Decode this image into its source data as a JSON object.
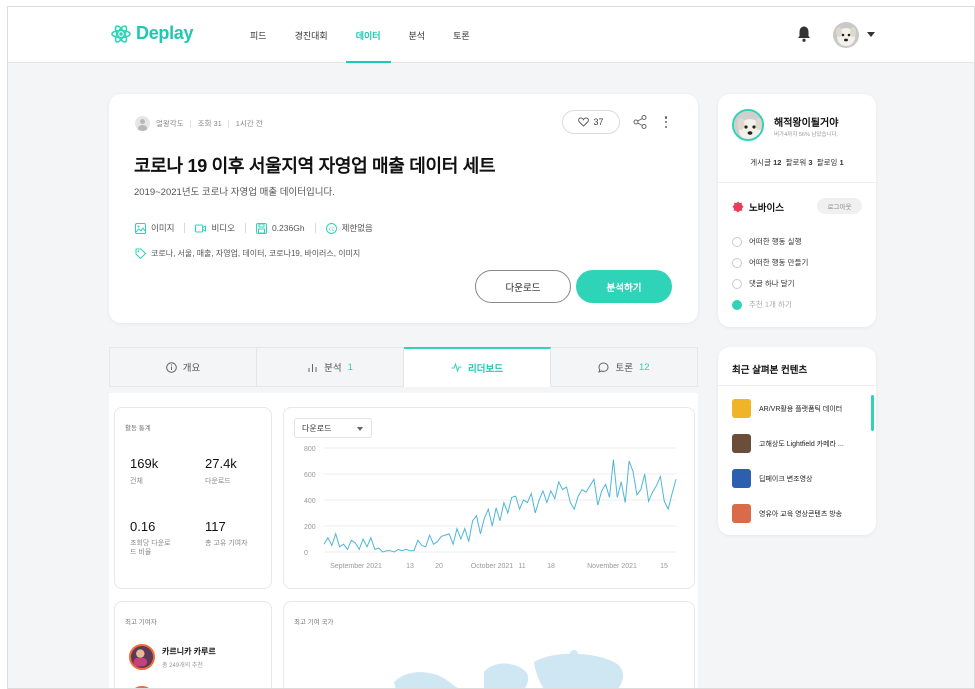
{
  "brand": {
    "name": "Deplay",
    "accent": "#2fd3b7"
  },
  "nav": [
    {
      "label": "피드"
    },
    {
      "label": "경진대회"
    },
    {
      "label": "데이터",
      "active": true
    },
    {
      "label": "분석"
    },
    {
      "label": "토론"
    }
  ],
  "post": {
    "author": "얼왕각도",
    "views": "조회 31",
    "time": "1시간 전",
    "likes": "37",
    "title": "코로나 19 이후 서울지역 자영업 매출 데이터 세트",
    "subtitle": "2019~2021년도 코로나 자영업 매출 데이터입니다.",
    "attrs": {
      "image": "이미지",
      "video": "비디오",
      "size": "0.236Gh",
      "license": "제한없음"
    },
    "tags": "코로나, 서울, 매출, 자영업, 데이터, 코로나19, 바이러스, 이미지",
    "download_label": "다운로드",
    "analyze_label": "분석하기"
  },
  "profile": {
    "name": "해적왕이될거야",
    "sub": "버가4까지 56% 남았습니다.",
    "stats": {
      "posts_label": "게시글",
      "posts": "12",
      "followers_label": "팔로워",
      "followers": "3",
      "following_label": "팔로잉",
      "following": "1"
    },
    "level": "노바이스",
    "logout": "로그아웃",
    "missions": [
      {
        "label": "어떠한 행동 실행",
        "done": false
      },
      {
        "label": "어떠한 행동 만들기",
        "done": false
      },
      {
        "label": "댓글 하나 달기",
        "done": false
      },
      {
        "label": "추천 1개 하기",
        "done": true
      }
    ]
  },
  "tabs": [
    {
      "label": "개요",
      "count": ""
    },
    {
      "label": "분석",
      "count": "1"
    },
    {
      "label": "리더보드",
      "count": "",
      "active": true
    },
    {
      "label": "토론",
      "count": "12"
    }
  ],
  "stats": {
    "title": "활동 통계",
    "items": [
      {
        "value": "169k",
        "label": "건체"
      },
      {
        "value": "27.4k",
        "label": "다운로드"
      },
      {
        "value": "0.16",
        "label": "조회당 다운로\n드 비율"
      },
      {
        "value": "117",
        "label": "총 고유 기여자"
      }
    ]
  },
  "chart_select": "다운로드",
  "chart_data": {
    "type": "line",
    "y_ticks": [
      "800",
      "600",
      "400",
      "200",
      "0"
    ],
    "ylim": [
      0,
      800
    ],
    "x_ticks": [
      "September 2021",
      "13",
      "20",
      "October 2021",
      "11",
      "18",
      "November 2021",
      "15"
    ],
    "values": [
      60,
      110,
      50,
      140,
      40,
      60,
      20,
      90,
      70,
      20,
      100,
      40,
      110,
      20,
      30,
      0,
      10,
      10,
      0,
      20,
      10,
      20,
      10,
      10,
      90,
      50,
      40,
      130,
      60,
      80,
      120,
      130,
      140,
      60,
      180,
      100,
      180,
      80,
      240,
      280,
      140,
      260,
      330,
      200,
      340,
      240,
      380,
      300,
      420,
      430,
      330,
      400,
      380,
      450,
      300,
      400,
      470,
      380,
      470,
      410,
      540,
      480,
      500,
      380,
      330,
      430,
      480,
      460,
      510,
      560,
      360,
      470,
      520,
      420,
      710,
      420,
      540,
      380,
      700,
      620,
      440,
      480,
      600,
      390,
      460,
      510,
      580,
      390,
      330,
      450,
      560
    ]
  },
  "contrib": {
    "title": "최고 기여자",
    "name": "카르니카 카루르",
    "sub": "총 249개의 추천"
  },
  "country": {
    "title": "최고 기여 국가"
  },
  "recent": {
    "title": "최근 살펴본 컨텐츠",
    "items": [
      {
        "label": "AR/VR활용 플랫폼틱 데이터",
        "color": "#f0b429"
      },
      {
        "label": "고해상도 Lightfield 카메라 ...",
        "color": "#6b4e3a"
      },
      {
        "label": "딥페이크 변조영상",
        "color": "#2d5fb0"
      },
      {
        "label": "영유아 교육 영상콘텐츠 방송",
        "color": "#d96b4a"
      }
    ]
  }
}
